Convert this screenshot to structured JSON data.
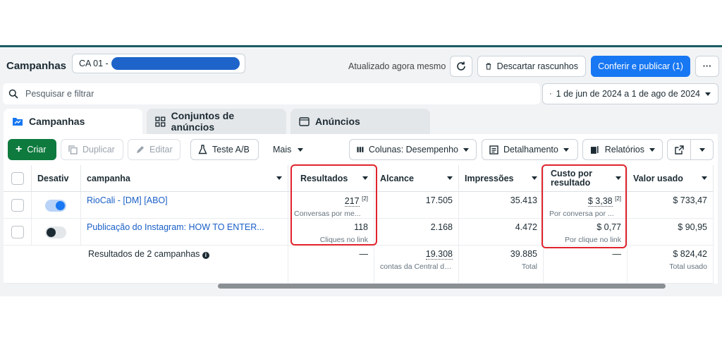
{
  "header": {
    "title": "Campanhas",
    "account_prefix": "CA 01 -",
    "updated_text": "Atualizado agora mesmo",
    "discard_label": "Descartar rascunhos",
    "publish_label": "Conferir e publicar (1)",
    "more_label": "···"
  },
  "search": {
    "placeholder": "Pesquisar e filtrar",
    "date_range": "1 de jun de 2024 a 1 de ago de 2024"
  },
  "tabs": [
    {
      "label": "Campanhas"
    },
    {
      "label": "Conjuntos de anúncios"
    },
    {
      "label": "Anúncios"
    }
  ],
  "toolbar": {
    "create": "Criar",
    "duplicate": "Duplicar",
    "edit": "Editar",
    "ab_test": "Teste A/B",
    "more": "Mais",
    "columns": "Colunas: Desempenho",
    "breakdown": "Detalhamento",
    "reports": "Relatórios"
  },
  "table": {
    "headers": {
      "toggle": "Desativ",
      "name": "campanha",
      "results": "Resultados",
      "reach": "Alcance",
      "impressions": "Impressões",
      "cost_line1": "Custo por",
      "cost_line2": "resultado",
      "spent": "Valor usado"
    },
    "rows": [
      {
        "name": "RioCali - [DM] [ABO]",
        "active": true,
        "results": "217",
        "results_note": "[2]",
        "results_sub": "Conversas por me...",
        "reach": "17.505",
        "impressions": "35.413",
        "cost": "$ 3,38",
        "cost_note": "[2]",
        "cost_sub": "Por conversa por ...",
        "spent": "$ 733,47"
      },
      {
        "name": "Publicação do Instagram: HOW TO ENTER...",
        "active": false,
        "results": "118",
        "results_sub": "Cliques no link",
        "reach": "2.168",
        "impressions": "4.472",
        "cost": "$ 0,77",
        "cost_sub": "Por clique no link",
        "spent": "$ 90,95"
      }
    ],
    "summary": {
      "label": "Resultados de 2 campanhas",
      "results": "—",
      "reach": "19.308",
      "reach_sub": "contas da Central de ...",
      "impressions": "39.885",
      "impressions_sub": "Total",
      "cost": "—",
      "spent": "$ 824,42",
      "spent_sub": "Total usado"
    }
  },
  "colors": {
    "accent": "#1877f2",
    "create": "#0e7a3e",
    "highlight": "#e0242d",
    "redacted": "#1e63c9"
  }
}
